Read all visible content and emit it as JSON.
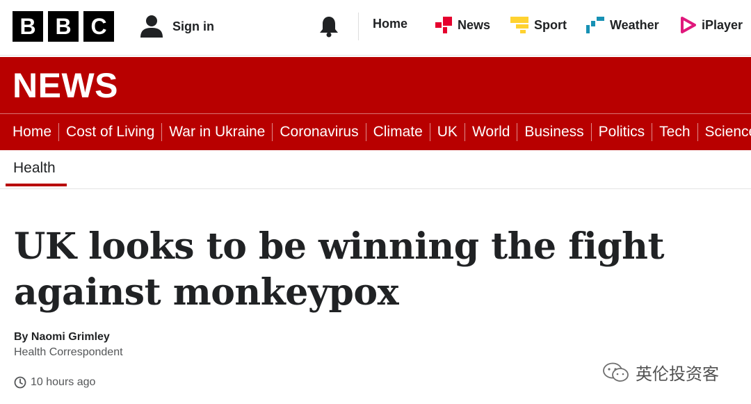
{
  "header": {
    "logo_letters": [
      "B",
      "B",
      "C"
    ],
    "sign_in_label": "Sign in",
    "nav": [
      {
        "label": "Home",
        "icon": "none"
      },
      {
        "label": "News",
        "icon": "news-icon",
        "color": "#e5002e"
      },
      {
        "label": "Sport",
        "icon": "sport-icon",
        "color": "#ffd230"
      },
      {
        "label": "Weather",
        "icon": "weather-icon",
        "color": "#1791b4"
      },
      {
        "label": "iPlayer",
        "icon": "iplayer-icon",
        "color": "#e0187c"
      }
    ]
  },
  "banner": {
    "title": "NEWS",
    "color": "#b80000"
  },
  "sections": [
    "Home",
    "Cost of Living",
    "War in Ukraine",
    "Coronavirus",
    "Climate",
    "UK",
    "World",
    "Business",
    "Politics",
    "Tech",
    "Science"
  ],
  "subnav": {
    "active": "Health"
  },
  "article": {
    "headline": "UK looks to be winning the fight against monkeypox",
    "author": "By Naomi Grimley",
    "role": "Health Correspondent",
    "timestamp": "10 hours ago"
  },
  "watermark": {
    "text": "英伦投资客"
  }
}
